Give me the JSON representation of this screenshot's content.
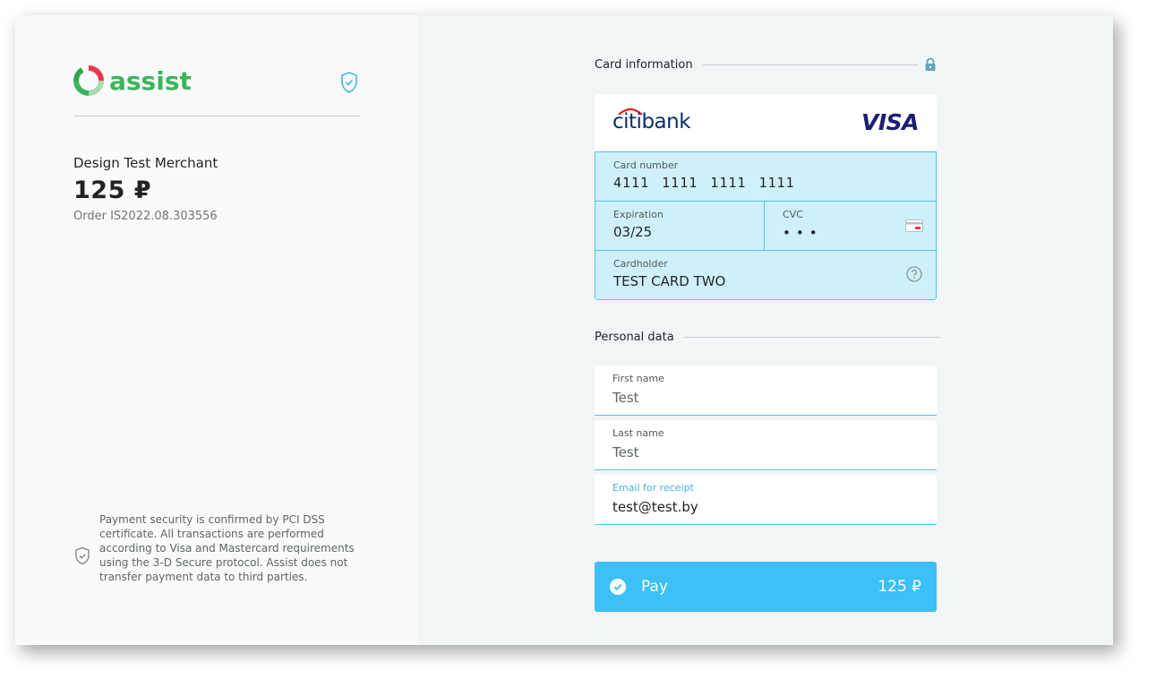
{
  "brand": {
    "name": "assist"
  },
  "merchant": {
    "name": "Design Test Merchant",
    "amount": "125 ₽",
    "order": "Order IS2022.08.303556"
  },
  "security_note": "Payment security is confirmed by PCI DSS certificate. All transactions are performed according to Visa and Mastercard requirements using the 3-D Secure protocol. Assist does not transfer payment data to third parties.",
  "card_section": {
    "title": "Card information",
    "bank_name": "citibank",
    "network": "VISA",
    "card_number": {
      "label": "Card number",
      "value": "4111 1111 1111 1111"
    },
    "expiration": {
      "label": "Expiration",
      "value": "03/25"
    },
    "cvc": {
      "label": "CVC",
      "value": "•••"
    },
    "cardholder": {
      "label": "Cardholder",
      "value": "TEST CARD TWO"
    }
  },
  "personal_section": {
    "title": "Personal data",
    "first_name": {
      "label": "First name",
      "value": "Test"
    },
    "last_name": {
      "label": "Last name",
      "value": "Test"
    },
    "email": {
      "label": "Email for receipt",
      "value": "test@test.by"
    }
  },
  "pay_button": {
    "label": "Pay",
    "amount": "125 ₽"
  },
  "colors": {
    "accent": "#3cc0f6",
    "field_bg": "#cff0fa",
    "field_border": "#56c3e6",
    "brand_green": "#3cb55a"
  }
}
